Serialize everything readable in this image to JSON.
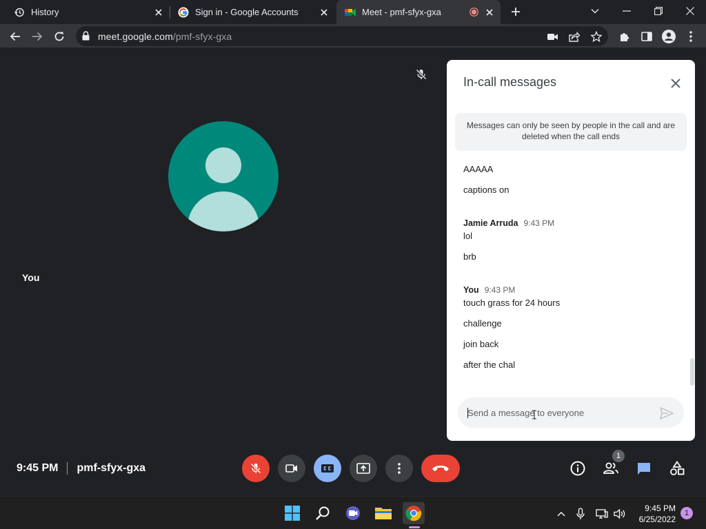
{
  "browser": {
    "tabs": [
      {
        "title": "History",
        "icon": "history-icon"
      },
      {
        "title": "Sign in - Google Accounts",
        "icon": "google-icon"
      },
      {
        "title": "Meet - pmf-sfyx-gxa",
        "icon": "meet-icon",
        "recording": true,
        "active": true
      }
    ],
    "url": {
      "host": "meet.google.com",
      "path": "/pmf-sfyx-gxa"
    }
  },
  "stage": {
    "self_tile_name": "You"
  },
  "chat": {
    "title": "In-call messages",
    "notice": "Messages can only be seen by people in the call and are deleted when the call ends",
    "groups": [
      {
        "sender": "",
        "time": "",
        "messages": [
          "AAAAA",
          "captions on"
        ]
      },
      {
        "sender": "Jamie Arruda",
        "time": "9:43 PM",
        "messages": [
          "lol",
          "brb"
        ]
      },
      {
        "sender": "You",
        "time": "9:43 PM",
        "messages": [
          "touch grass for 24 hours",
          "challenge",
          "join back",
          "after the chal"
        ]
      }
    ],
    "composer_placeholder": "Send a message to everyone"
  },
  "controls": {
    "time": "9:45 PM",
    "meeting_code": "pmf-sfyx-gxa",
    "people_badge": "1",
    "buttons": [
      "mic-off",
      "camera",
      "captions",
      "present",
      "more",
      "leave-call"
    ],
    "colors": {
      "danger": "#ea4335",
      "active": "#8ab4f8",
      "neutral": "#3c4043"
    }
  },
  "taskbar": {
    "time": "9:45 PM",
    "date": "6/25/2022",
    "notifications": "1"
  }
}
